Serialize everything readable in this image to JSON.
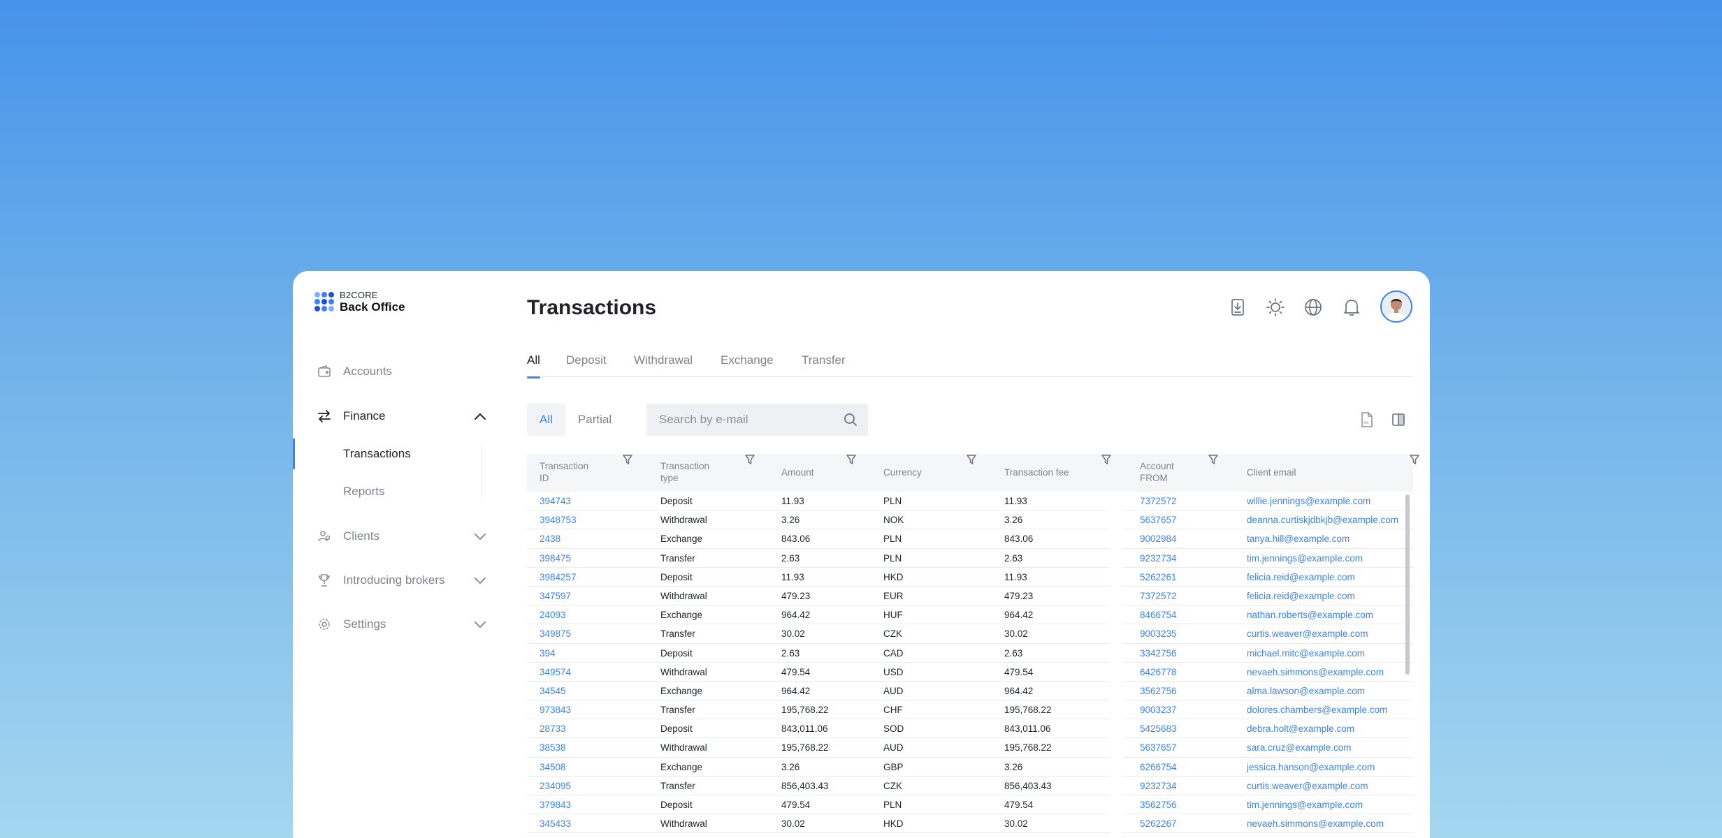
{
  "logo": {
    "sub": "B2CORE",
    "main": "Back Office"
  },
  "sidebar": {
    "items": [
      {
        "label": "Accounts",
        "icon": "wallet-icon"
      },
      {
        "label": "Finance",
        "icon": "transfer-arrows-icon",
        "expanded": true,
        "children": [
          {
            "label": "Transactions",
            "active": true
          },
          {
            "label": "Reports"
          }
        ]
      },
      {
        "label": "Clients",
        "icon": "user-group-icon"
      },
      {
        "label": "Introducing brokers",
        "icon": "trophy-icon"
      },
      {
        "label": "Settings",
        "icon": "gear-icon"
      }
    ]
  },
  "header": {
    "title": "Transactions",
    "icons": [
      "download-icon",
      "sun-icon",
      "globe-icon",
      "bell-icon"
    ]
  },
  "tabs": [
    "All",
    "Deposit",
    "Withdrawal",
    "Exchange",
    "Transfer"
  ],
  "active_tab": "All",
  "segment": [
    "All",
    "Partial"
  ],
  "search": {
    "placeholder": "Search by e-mail"
  },
  "table": {
    "columns": [
      [
        "Transaction",
        "ID"
      ],
      [
        "Transaction",
        "type"
      ],
      [
        "Amount",
        ""
      ],
      [
        "Currency",
        ""
      ],
      [
        "Transaction fee",
        ""
      ],
      [
        "Account",
        "FROM"
      ],
      [
        "Client email",
        ""
      ]
    ],
    "rows": [
      [
        "394743",
        "Deposit",
        "11.93",
        "PLN",
        "11.93",
        "7372572",
        "willie.jennings@example.com"
      ],
      [
        "3948753",
        "Withdrawal",
        "3.26",
        "NOK",
        "3.26",
        "5637657",
        "deanna.curtiskjdbkjb@example.com"
      ],
      [
        "2438",
        "Exchange",
        "843.06",
        "PLN",
        "843.06",
        "9002984",
        "tanya.hill@example.com"
      ],
      [
        "398475",
        "Transfer",
        "2.63",
        "PLN",
        "2.63",
        "9232734",
        "tim.jennings@example.com"
      ],
      [
        "3984257",
        "Deposit",
        "11.93",
        "HKD",
        "11.93",
        "5262261",
        "felicia.reid@example.com"
      ],
      [
        "347597",
        "Withdrawal",
        "479.23",
        "EUR",
        "479.23",
        "7372572",
        "felicia.reid@example.com"
      ],
      [
        "24093",
        "Exchange",
        "964.42",
        "HUF",
        "964.42",
        "8466754",
        "nathan.roberts@example.com"
      ],
      [
        "349875",
        "Transfer",
        "30.02",
        "CZK",
        "30.02",
        "9003235",
        "curtis.weaver@example.com"
      ],
      [
        "394",
        "Deposit",
        "2.63",
        "CAD",
        "2.63",
        "3342756",
        "michael.mitc@example.com"
      ],
      [
        "349574",
        "Withdrawal",
        "479.54",
        "USD",
        "479.54",
        "6426778",
        "nevaeh.simmons@example.com"
      ],
      [
        "34545",
        "Exchange",
        "964.42",
        "AUD",
        "964.42",
        "3562756",
        "alma.lawson@example.com"
      ],
      [
        "973843",
        "Transfer",
        "195,768.22",
        "CHF",
        "195,768.22",
        "9003237",
        "dolores.chambers@example.com"
      ],
      [
        "28733",
        "Deposit",
        "843,011.06",
        "SOD",
        "843,011.06",
        "5425683",
        "debra.holt@example.com"
      ],
      [
        "38538",
        "Withdrawal",
        "195,768.22",
        "AUD",
        "195,768.22",
        "5637657",
        "sara.cruz@example.com"
      ],
      [
        "34508",
        "Exchange",
        "3.26",
        "GBP",
        "3.26",
        "6266754",
        "jessica.hanson@example.com"
      ],
      [
        "234095",
        "Transfer",
        "856,403.43",
        "CZK",
        "856,403.43",
        "9232734",
        "curtis.weaver@example.com"
      ],
      [
        "379843",
        "Deposit",
        "479.54",
        "PLN",
        "479.54",
        "3562756",
        "tim.jennings@example.com"
      ],
      [
        "345433",
        "Withdrawal",
        "30.02",
        "HKD",
        "30.02",
        "5262267",
        "nevaeh.simmons@example.com"
      ]
    ]
  },
  "colors": {
    "accent": "#3b82f6",
    "link": "#3b82f6",
    "muted": "#7d838c"
  }
}
